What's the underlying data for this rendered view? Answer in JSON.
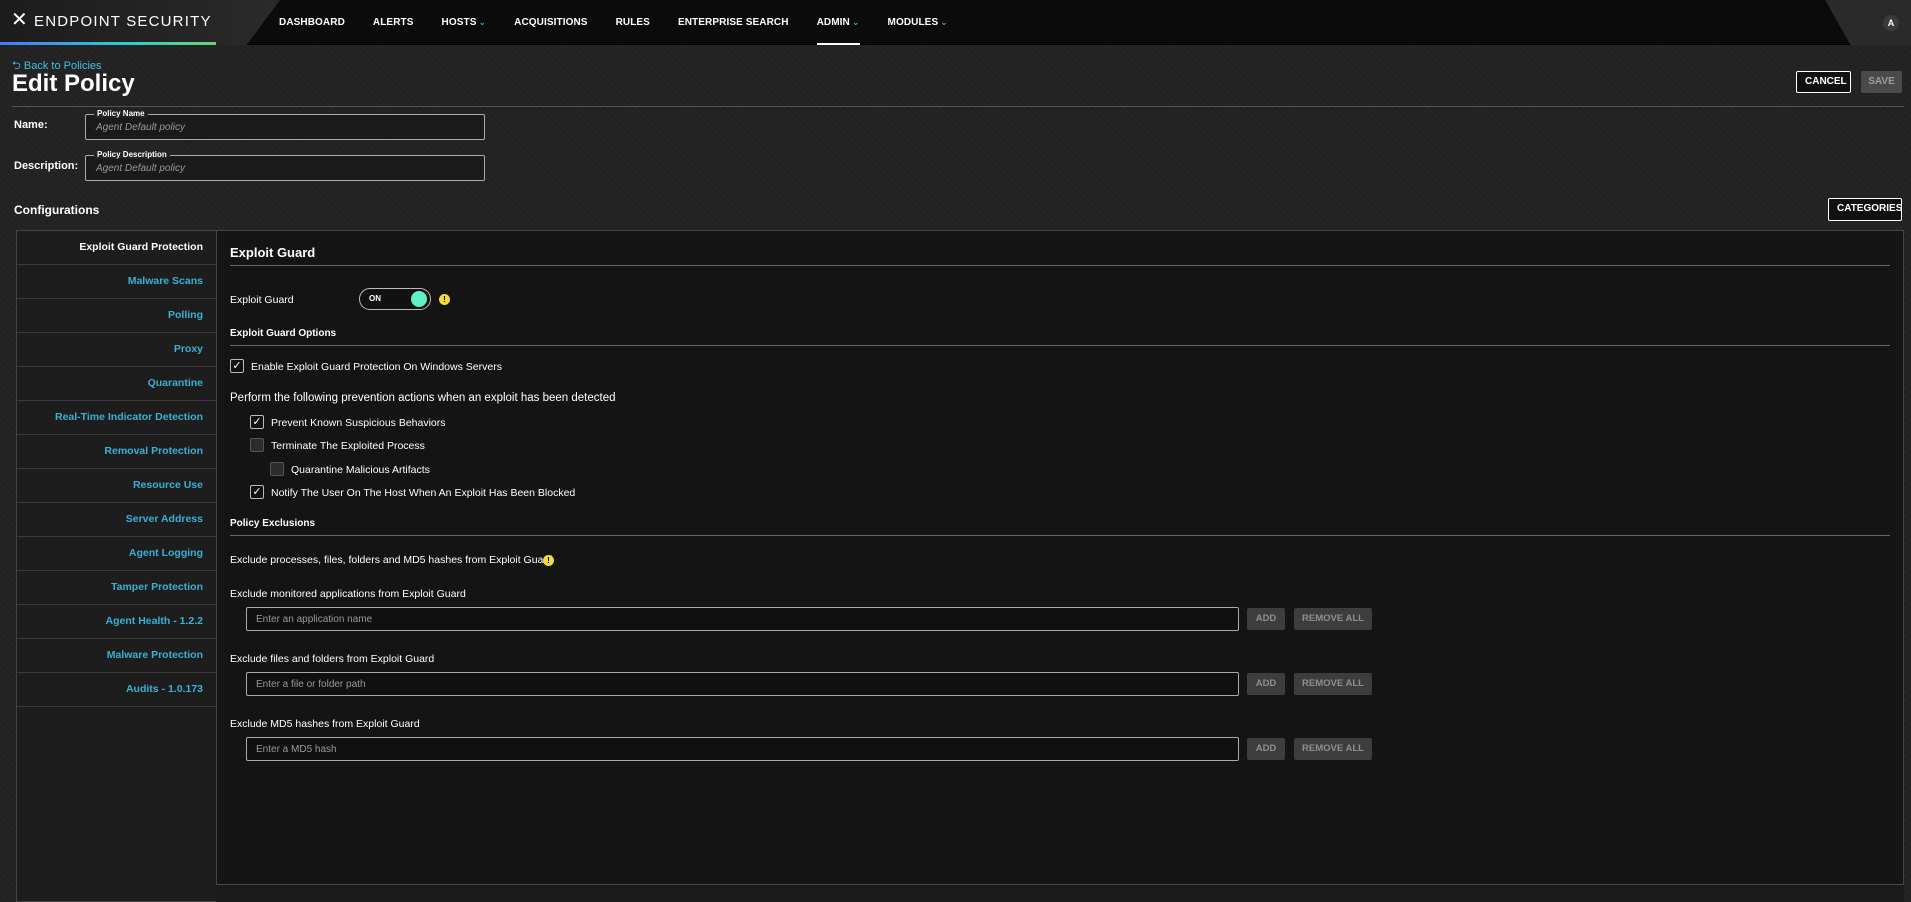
{
  "app": {
    "brand": "ENDPOINT SECURITY",
    "user_initial": "A"
  },
  "nav": {
    "items": [
      "DASHBOARD",
      "ALERTS",
      "HOSTS",
      "ACQUISITIONS",
      "RULES",
      "ENTERPRISE SEARCH",
      "ADMIN",
      "MODULES"
    ],
    "active": "ADMIN"
  },
  "header": {
    "back_label": "Back to Policies",
    "title": "Edit Policy",
    "cancel_label": "CANCEL",
    "save_label": "SAVE"
  },
  "form": {
    "name_label": "Name:",
    "name_legend": "Policy Name",
    "name_value": "Agent Default policy",
    "desc_label": "Description:",
    "desc_legend": "Policy Description",
    "desc_value": "Agent Default policy"
  },
  "config": {
    "title": "Configurations",
    "categories_label": "CATEGORIES"
  },
  "sidebar": {
    "items": [
      "Exploit Guard Protection",
      "Malware Scans",
      "Polling",
      "Proxy",
      "Quarantine",
      "Real-Time Indicator Detection",
      "Removal Protection",
      "Resource Use",
      "Server Address",
      "Agent Logging",
      "Tamper Protection",
      "Agent Health - 1.2.2",
      "Malware Protection",
      "Audits - 1.0.173"
    ],
    "active_index": 0
  },
  "panel": {
    "title": "Exploit Guard",
    "toggle_label": "Exploit Guard",
    "toggle_state": "ON",
    "options_title": "Exploit Guard Options",
    "enable_servers": {
      "label": "Enable Exploit Guard Protection On Windows Servers",
      "checked": true
    },
    "prevention_intro": "Perform the following prevention actions when an exploit has been detected",
    "actions": [
      {
        "label": "Prevent Known Suspicious Behaviors",
        "checked": true
      },
      {
        "label": "Terminate The Exploited Process",
        "checked": false
      },
      {
        "label": "Quarantine Malicious Artifacts",
        "checked": false
      },
      {
        "label": "Notify The User On The Host When An Exploit Has Been Blocked",
        "checked": true
      }
    ],
    "exclusions_title": "Policy Exclusions",
    "exclusions_intro": "Exclude processes, files, folders and MD5 hashes from Exploit Guard",
    "exclusion_groups": [
      {
        "label": "Exclude monitored applications from Exploit Guard",
        "placeholder": "Enter an application name",
        "add": "ADD",
        "remove": "REMOVE ALL"
      },
      {
        "label": "Exclude files and folders from Exploit Guard",
        "placeholder": "Enter a file or folder path",
        "add": "ADD",
        "remove": "REMOVE ALL"
      },
      {
        "label": "Exclude MD5 hashes from Exploit Guard",
        "placeholder": "Enter a MD5 hash",
        "add": "ADD",
        "remove": "REMOVE ALL"
      }
    ]
  },
  "colors": {
    "accent": "#3ab0d6",
    "toggle_on": "#5ef0c6",
    "warning": "#f2dc3a"
  }
}
